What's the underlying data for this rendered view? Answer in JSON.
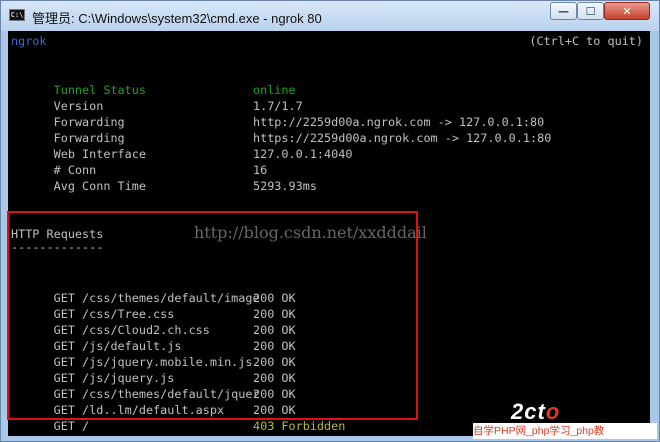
{
  "window": {
    "title": "管理员: C:\\Windows\\system32\\cmd.exe - ngrok  80",
    "icon_text": "C:\\",
    "minimize": "—",
    "maximize": "☐",
    "close": "✕"
  },
  "console": {
    "app_name": "ngrok",
    "quit_hint": "(Ctrl+C to quit)",
    "status": [
      {
        "key": "Tunnel Status",
        "value": "online"
      },
      {
        "key": "Version",
        "value": "1.7/1.7"
      },
      {
        "key": "Forwarding",
        "value": "http://2259d00a.ngrok.com -> 127.0.0.1:80"
      },
      {
        "key": "Forwarding",
        "value": "https://2259d00a.ngrok.com -> 127.0.0.1:80"
      },
      {
        "key": "Web Interface",
        "value": "127.0.0.1:4040"
      },
      {
        "key": "# Conn",
        "value": "16"
      },
      {
        "key": "Avg Conn Time",
        "value": "5293.93ms"
      }
    ],
    "requests_heading": "HTTP Requests",
    "requests_underline": "-------------",
    "requests": [
      {
        "request": "GET /css/themes/default/image",
        "status": "200 OK"
      },
      {
        "request": "GET /css/Tree.css",
        "status": "200 OK"
      },
      {
        "request": "GET /css/Cloud2.ch.css",
        "status": "200 OK"
      },
      {
        "request": "GET /js/default.js",
        "status": "200 OK"
      },
      {
        "request": "GET /js/jquery.mobile.min.js",
        "status": "200 OK"
      },
      {
        "request": "GET /js/jquery.js",
        "status": "200 OK"
      },
      {
        "request": "GET /css/themes/default/jquer",
        "status": "200 OK"
      },
      {
        "request": "GET /ld..lm/default.aspx",
        "status": "200 OK"
      },
      {
        "request": "GET /",
        "status": "403 Forbidden"
      }
    ]
  },
  "watermark": "http://blog.csdn.net/xxdddail",
  "brand": {
    "logo_a": "2c",
    "logo_b": "t",
    "logo_c": "o",
    "caption": "自学PHP网_php学习_php教"
  },
  "colors": {
    "console_bg": "#000000",
    "console_text": "#c0c0c0",
    "status_green": "#1fa31f",
    "app_blue": "#2f6fd6",
    "forbidden_yellow": "#b8b83a",
    "annotation_red": "#e01010"
  }
}
